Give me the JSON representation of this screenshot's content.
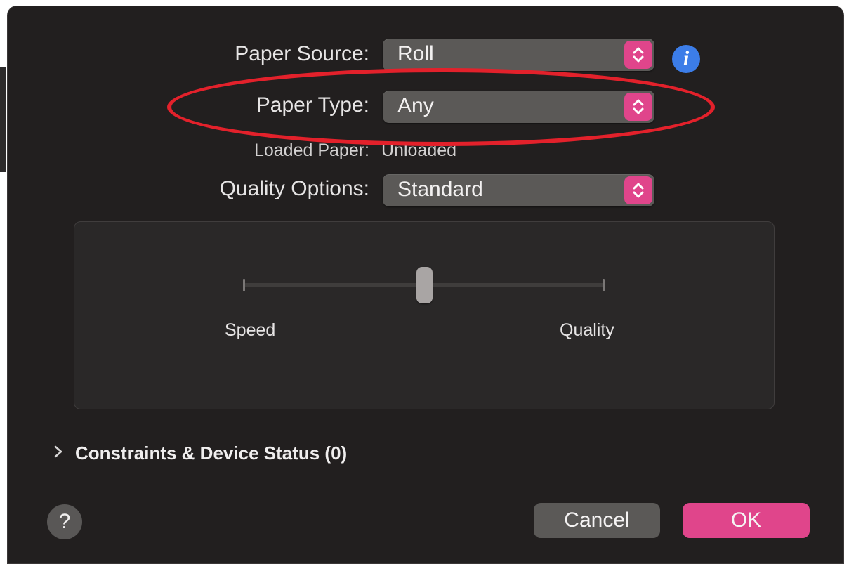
{
  "form": {
    "paper_source_label": "Paper Source:",
    "paper_source_value": "Roll",
    "paper_type_label": "Paper Type:",
    "paper_type_value": "Any",
    "loaded_paper_label": "Loaded Paper:",
    "loaded_paper_value": "Unloaded",
    "quality_options_label": "Quality Options:",
    "quality_options_value": "Standard"
  },
  "slider": {
    "min_label": "Speed",
    "max_label": "Quality",
    "level": 0.5
  },
  "constraints": {
    "label": "Constraints & Device Status (0)"
  },
  "buttons": {
    "help": "?",
    "cancel": "Cancel",
    "ok": "OK"
  },
  "icons": {
    "info": "i",
    "stepper": "up-down-chevron-icon",
    "disclosure": "chevron-right-icon"
  },
  "colors": {
    "window_bg": "#221f1f",
    "accent": "#e0458b",
    "info_blue": "#3c7de8",
    "annotation_red": "#e3212b"
  }
}
